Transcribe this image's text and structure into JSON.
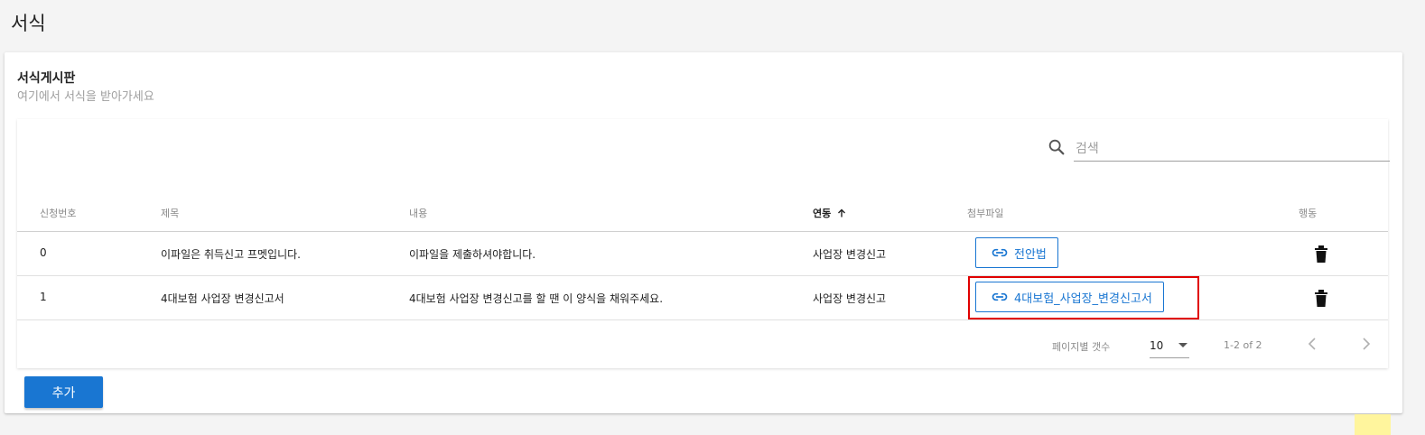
{
  "page": {
    "title": "서식"
  },
  "card": {
    "title": "서식게시판",
    "subtitle": "여기에서 서식을 받아가세요"
  },
  "search": {
    "placeholder": "검색",
    "value": ""
  },
  "table": {
    "columns": [
      "신청번호",
      "제목",
      "내용",
      "연동",
      "첨부파일",
      "행동"
    ],
    "sorted_column": "연동",
    "rows": [
      {
        "no": "0",
        "title": "이파일은 취득신고 프멧입니다.",
        "content": "이파일을 제출하셔야합니다.",
        "linked": "사업장 변경신고",
        "attachment": "전안법"
      },
      {
        "no": "1",
        "title": "4대보험 사업장 변경신고서",
        "content": "4대보험 사업장 변경신고를 할 땐 이 양식을 채워주세요.",
        "linked": "사업장 변경신고",
        "attachment": "4대보험_사업장_변경신고서"
      }
    ]
  },
  "pagination": {
    "rows_per_page_label": "페이지별 갯수",
    "rows_per_page": "10",
    "range": "1-2 of 2"
  },
  "actions": {
    "add_label": "추가"
  },
  "colors": {
    "primary": "#1976d2",
    "highlight": "#e00000",
    "background": "#f4f4f4"
  },
  "icons": {
    "search": "search-icon",
    "link": "link-icon",
    "delete": "trash-icon",
    "sort": "arrow-up-icon",
    "prev": "chevron-left-icon",
    "next": "chevron-right-icon"
  }
}
